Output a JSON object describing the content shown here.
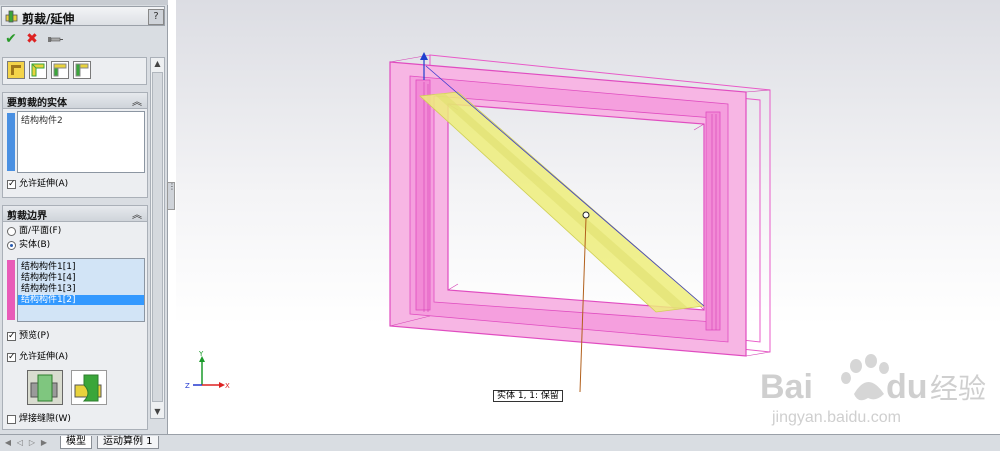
{
  "window": {
    "title": "剪裁/延伸",
    "help_symbol": "?"
  },
  "toolbar": {
    "ok_symbol": "✔",
    "cancel_symbol": "✖"
  },
  "trim_entities_group": {
    "title": "要剪裁的实体",
    "items": [
      "结构构件2"
    ],
    "allow_extend_label": "允许延伸(A)",
    "allow_extend_checked": true
  },
  "trim_boundary_group": {
    "title": "剪裁边界",
    "option_face_label": "面/平面(F)",
    "option_body_label": "实体(B)",
    "selected_option": "实体(B)",
    "items": [
      "结构构件1[1]",
      "结构构件1[4]",
      "结构构件1[3]",
      "结构构件1[2]"
    ],
    "selected_item": "结构构件1[2]",
    "preview_label": "预览(P)",
    "preview_checked": true,
    "allow_extend_label": "允许延伸(A)",
    "allow_extend_checked": true,
    "weld_gap_label": "焊接缝隙(W)",
    "weld_gap_checked": false
  },
  "tabs": {
    "model": "模型",
    "motion_study": "运动算例 1"
  },
  "viewport": {
    "callout_label": "实体 1, 1: 保留",
    "axis_labels": {
      "x": "X",
      "y": "Y",
      "z": "Z"
    }
  },
  "watermark": {
    "brand": "Bai",
    "brand_suffix": "du",
    "brand_cn": "经验",
    "url": "jingyan.baidu.com"
  },
  "colors": {
    "frame_pink": "#f06bd0",
    "member_yellow": "#eded7a",
    "selection_blue": "#3399ff",
    "ok_green": "#2a9a2a",
    "cancel_red": "#dd2222"
  },
  "icons": [
    "trim-extend-icon",
    "help-icon",
    "ok-icon",
    "cancel-icon",
    "pushpin-icon",
    "corner-end-trim-icon",
    "corner-miter-icon",
    "corner-end-butt1-icon",
    "corner-end-butt2-icon",
    "simple-cut-icon",
    "coped-cut-icon",
    "collapse-chevron-icon",
    "triad-icon"
  ]
}
